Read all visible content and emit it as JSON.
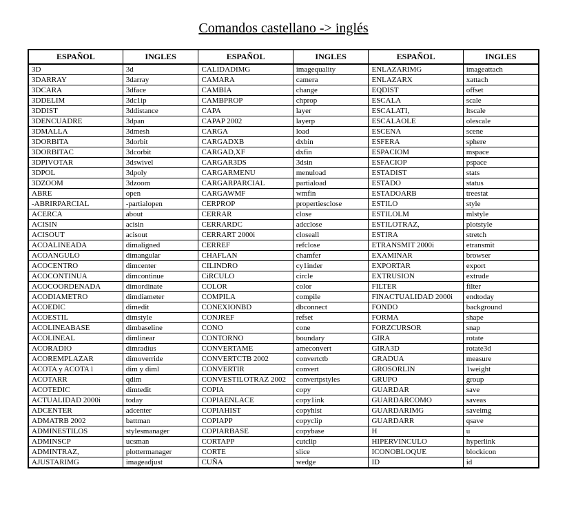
{
  "title": "Comandos castellano -> inglés",
  "headers": {
    "spanish": "ESPAÑOL",
    "english": "INGLES"
  },
  "columns": [
    [
      {
        "es": "3D",
        "en": "3d"
      },
      {
        "es": "3DARRAY",
        "en": "3darray"
      },
      {
        "es": "3DCARA",
        "en": "3dface"
      },
      {
        "es": "3DDELIM",
        "en": "3dc1ip"
      },
      {
        "es": "3DDIST",
        "en": "3ddistance"
      },
      {
        "es": "3DENCUADRE",
        "en": "3dpan"
      },
      {
        "es": "3DMALLA",
        "en": "3dmesh"
      },
      {
        "es": "3DORBITA",
        "en": "3dorbit"
      },
      {
        "es": "3DORBITAC",
        "en": "3dcorbit"
      },
      {
        "es": "3DPIVOTAR",
        "en": "3dswivel"
      },
      {
        "es": "3DPOL",
        "en": "3dpoly"
      },
      {
        "es": "3DZOOM",
        "en": "3dzoom"
      },
      {
        "es": "ABRE",
        "en": "open"
      },
      {
        "es": "-ABRIRPARCIAL",
        "en": "-partialopen"
      },
      {
        "es": "ACERCA",
        "en": "about"
      },
      {
        "es": "ACISIN",
        "en": "acisin"
      },
      {
        "es": "ACISOUT",
        "en": "acisout"
      },
      {
        "es": "ACOALINEADA",
        "en": "dimaligned"
      },
      {
        "es": "ACOANGULO",
        "en": "dimangular"
      },
      {
        "es": "ACOCENTRO",
        "en": "dimcenter"
      },
      {
        "es": "ACOCONTINUA",
        "en": "dimcontinue"
      },
      {
        "es": "ACOCOORDENADA",
        "en": "dimordinate"
      },
      {
        "es": "ACODIAMETRO",
        "en": "dimdiameter"
      },
      {
        "es": "ACOEDIC",
        "en": "dimedit"
      },
      {
        "es": "ACOESTIL",
        "en": "dimstyle"
      },
      {
        "es": "ACOLINEABASE",
        "en": "dimbaseline"
      },
      {
        "es": "ACOLINEAL",
        "en": "dimlinear"
      },
      {
        "es": "ACORADIO",
        "en": "dimradius"
      },
      {
        "es": "ACOREMPLAZAR",
        "en": "dimoverride"
      },
      {
        "es": "ACOTA y ACOTA l",
        "en": "dim y diml"
      },
      {
        "es": "ACOTARR",
        "en": "qdim"
      },
      {
        "es": "ACOTEDIC",
        "en": "dimtedit"
      },
      {
        "es": "ACTUALIDAD 2000i",
        "en": "today"
      },
      {
        "es": "ADCENTER",
        "en": "adcenter"
      },
      {
        "es": "ADMATRB 2002",
        "en": "battman"
      },
      {
        "es": "ADMINESTILOS",
        "en": "stylesmanager"
      },
      {
        "es": "ADMINSCP",
        "en": "ucsman"
      },
      {
        "es": "ADMINTRAZ,",
        "en": "plottermanager"
      },
      {
        "es": "AJUSTARIMG",
        "en": "imageadjust"
      }
    ],
    [
      {
        "es": "CALIDADIMG",
        "en": "imagequality"
      },
      {
        "es": "CAMARA",
        "en": "camera"
      },
      {
        "es": "CAMBIA",
        "en": "change"
      },
      {
        "es": "CAMBPROP",
        "en": "chprop"
      },
      {
        "es": "CAPA",
        "en": "layer"
      },
      {
        "es": "CAPAP 2002",
        "en": "layerp"
      },
      {
        "es": "CARGA",
        "en": "load"
      },
      {
        "es": "CARGADXB",
        "en": "dxbin"
      },
      {
        "es": "CARGAD,XF",
        "en": "dxfin"
      },
      {
        "es": "CARGAR3DS",
        "en": "3dsin"
      },
      {
        "es": "CARGARMENU",
        "en": "menuload"
      },
      {
        "es": "CARGARPARCIAL",
        "en": "partiaload"
      },
      {
        "es": "CARGAWMF",
        "en": "wmfin"
      },
      {
        "es": "CERPROP",
        "en": "propertiesclose"
      },
      {
        "es": "CERRAR",
        "en": "close"
      },
      {
        "es": "CERRARDC",
        "en": "adcclose"
      },
      {
        "es": "CERRART 2000i",
        "en": "closeall"
      },
      {
        "es": "CERREF",
        "en": "refclose"
      },
      {
        "es": "CHAFLAN",
        "en": "chamfer"
      },
      {
        "es": "CILINDRO",
        "en": "cy1inder"
      },
      {
        "es": "CiRCULO",
        "en": "circle"
      },
      {
        "es": "COLOR",
        "en": "color"
      },
      {
        "es": "COMPILA",
        "en": "compile"
      },
      {
        "es": "CONEXIONBD",
        "en": "dbconnect"
      },
      {
        "es": "CONJREF",
        "en": "refset"
      },
      {
        "es": "CONO",
        "en": "cone"
      },
      {
        "es": "CONTORNO",
        "en": "boundary"
      },
      {
        "es": "CONVERTAME",
        "en": "ameconvert"
      },
      {
        "es": "CONVERTCTB 2002",
        "en": "convertctb"
      },
      {
        "es": "CONVERTIR",
        "en": "convert"
      },
      {
        "es": "CONVESTILOTRAZ 2002",
        "en": "convertpstyles"
      },
      {
        "es": "COPIA",
        "en": "copy"
      },
      {
        "es": "COPIAENLACE",
        "en": "copy1ink"
      },
      {
        "es": "COPIAHIST",
        "en": "copyhist"
      },
      {
        "es": "COPIAPP",
        "en": "copyclip"
      },
      {
        "es": "COPIARBASE",
        "en": "copybase"
      },
      {
        "es": "CORTAPP",
        "en": "cutclip"
      },
      {
        "es": "CORTE",
        "en": "slice"
      },
      {
        "es": "CUÑA",
        "en": "wedge"
      }
    ],
    [
      {
        "es": "ENLAZARIMG",
        "en": "imageattach"
      },
      {
        "es": "ENLAZARX",
        "en": "xattach"
      },
      {
        "es": "EQDIST",
        "en": "offset"
      },
      {
        "es": "ESCALA",
        "en": "scale"
      },
      {
        "es": "ESCALATI,",
        "en": "ltscale"
      },
      {
        "es": "ESCALAOLE",
        "en": "olescale"
      },
      {
        "es": "ESCENA",
        "en": "scene"
      },
      {
        "es": "ESFERA",
        "en": "sphere"
      },
      {
        "es": "ESPACIOM",
        "en": "mspace"
      },
      {
        "es": "ESFACIOP",
        "en": "pspace"
      },
      {
        "es": "ESTADIST",
        "en": "stats"
      },
      {
        "es": "ESTADO",
        "en": "status"
      },
      {
        "es": "ESTADOARB",
        "en": "treestat"
      },
      {
        "es": "ESTILO",
        "en": "style"
      },
      {
        "es": "ESTILOLM",
        "en": "mlstyle"
      },
      {
        "es": "ESTILOTRAZ,",
        "en": "plotstyle"
      },
      {
        "es": "ESTIRA",
        "en": "stretch"
      },
      {
        "es": "ETRANSMIT 2000i",
        "en": "etransmit"
      },
      {
        "es": "EXAMINAR",
        "en": "browser"
      },
      {
        "es": "EXPORTAR",
        "en": "export"
      },
      {
        "es": "EXTRUSION",
        "en": "extrude"
      },
      {
        "es": "FILTER",
        "en": "filter"
      },
      {
        "es": "FINACTUALIDAD 2000i",
        "en": "endtoday"
      },
      {
        "es": "FONDO",
        "en": "background"
      },
      {
        "es": "FORMA",
        "en": "shape"
      },
      {
        "es": "FORZCURSOR",
        "en": "snap"
      },
      {
        "es": "GIRA",
        "en": "rotate"
      },
      {
        "es": "GIRA3D",
        "en": "rotate3d"
      },
      {
        "es": "GRADUA",
        "en": "measure"
      },
      {
        "es": "GROSORLIN",
        "en": "1weight"
      },
      {
        "es": "GRUPO",
        "en": "group"
      },
      {
        "es": "GUARDAR",
        "en": "save"
      },
      {
        "es": "GUARDARCOMO",
        "en": "saveas"
      },
      {
        "es": "GUARDARIMG",
        "en": "saveimg"
      },
      {
        "es": "GUARDARR",
        "en": "qsave"
      },
      {
        "es": "H",
        "en": "u"
      },
      {
        "es": "HIPERVINCULO",
        "en": "hyperlink"
      },
      {
        "es": "ICONOBLOQUE",
        "en": "blockicon"
      },
      {
        "es": "ID",
        "en": "id"
      }
    ]
  ]
}
